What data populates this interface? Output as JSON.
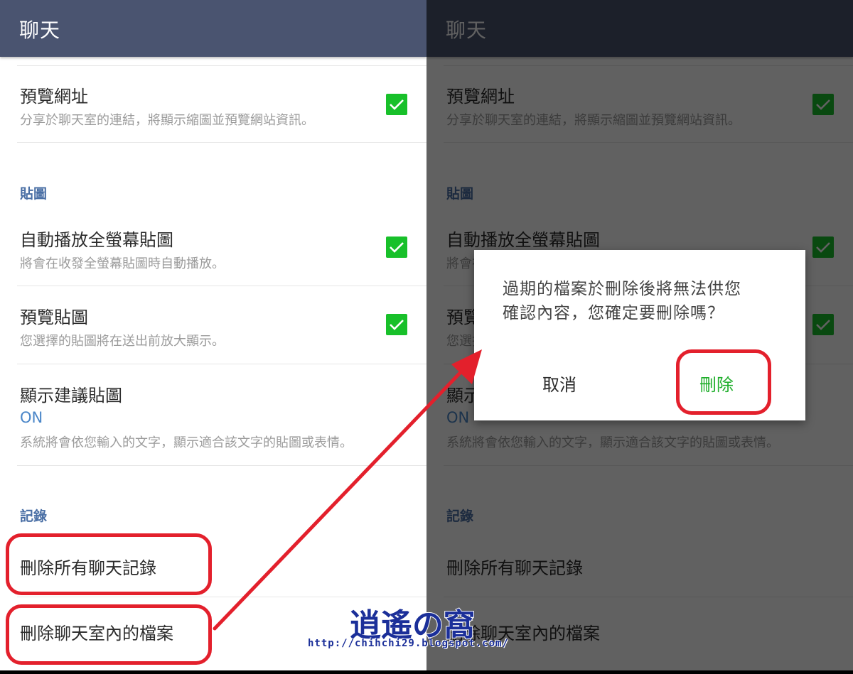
{
  "screen_title": "聊天",
  "items": {
    "url_preview": {
      "title": "預覽網址",
      "desc": "分享於聊天室的連結，將顯示縮圖並預覽網站資訊。",
      "checked": true
    },
    "sticker_section": "貼圖",
    "autoplay": {
      "title": "自動播放全螢幕貼圖",
      "desc": "將會在收發全螢幕貼圖時自動播放。",
      "checked": true
    },
    "sticker_preview": {
      "title": "預覽貼圖",
      "desc": "您選擇的貼圖將在送出前放大顯示。",
      "checked": true
    },
    "suggest": {
      "title": "顯示建議貼圖",
      "value": "ON",
      "desc": "系統將會依您輸入的文字，顯示適合該文字的貼圖或表情。"
    },
    "history_section": "記錄",
    "delete_all": "刪除所有聊天記錄",
    "delete_files": "刪除聊天室內的檔案"
  },
  "dialog": {
    "line1": "過期的檔案於刪除後將無法供您",
    "line2": "確認內容，您確定要刪除嗎？",
    "cancel": "取消",
    "delete": "刪除"
  },
  "watermark": {
    "logo_text": "逍遙の窩",
    "url": "http://chihchi29.blogspot.com/"
  },
  "colors": {
    "appbar": "#4a5470",
    "checkbox": "#18c02a",
    "section_label": "#4a6fa5",
    "on_value": "#4a86c8",
    "delete_button": "#1fae2b",
    "highlight": "#e3202c"
  }
}
